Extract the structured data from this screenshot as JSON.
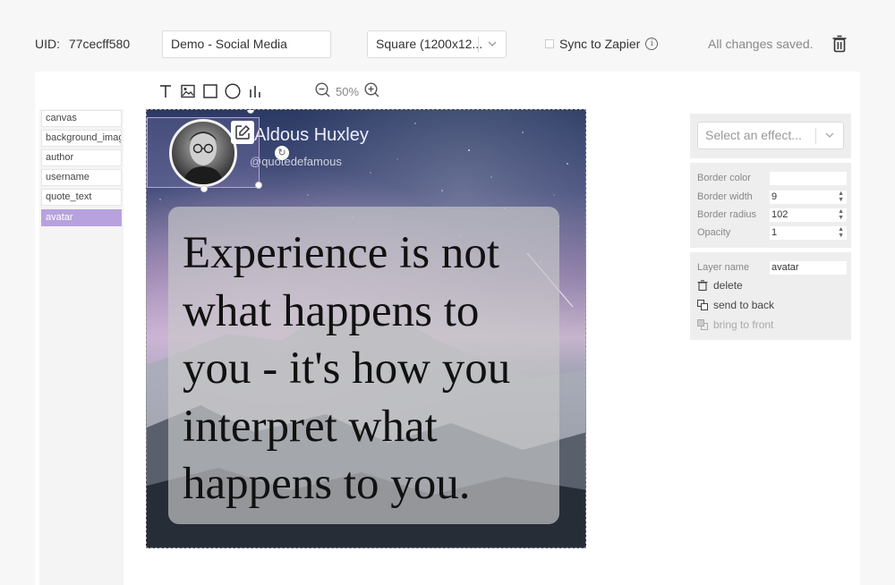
{
  "header": {
    "uid_label": "UID:",
    "uid_value": "77cecff580",
    "document_name": "Demo - Social Media",
    "size_selected": "Square (1200x12...",
    "sync_label": "Sync to Zapier",
    "sync_checked": false,
    "save_status": "All changes saved."
  },
  "toolbar": {
    "tools": [
      "text-icon",
      "image-icon",
      "square-icon",
      "circle-icon",
      "chart-icon"
    ],
    "zoom_level": "50%"
  },
  "layers": {
    "items": [
      {
        "label": "canvas",
        "active": false
      },
      {
        "label": "background_image",
        "active": false
      },
      {
        "label": "author",
        "active": false
      },
      {
        "label": "username",
        "active": false
      },
      {
        "label": "quote_text",
        "active": false
      },
      {
        "label": "avatar",
        "active": true
      }
    ]
  },
  "canvas": {
    "author": "Aldous Huxley",
    "username": "@quotedefamous",
    "quote": "Experience is not what happens to you - it's how you interpret what happens to you."
  },
  "properties": {
    "effect_placeholder": "Select an effect...",
    "border_color_label": "Border color",
    "border_color_value": "",
    "border_width_label": "Border width",
    "border_width_value": "9",
    "border_radius_label": "Border radius",
    "border_radius_value": "102",
    "opacity_label": "Opacity",
    "opacity_value": "1",
    "layer_name_label": "Layer name",
    "layer_name_value": "avatar",
    "delete_label": "delete",
    "send_to_back_label": "send to back",
    "bring_to_front_label": "bring to front"
  },
  "colors": {
    "accent": "#b7a2dd",
    "panel_bg": "#eeeeef"
  }
}
